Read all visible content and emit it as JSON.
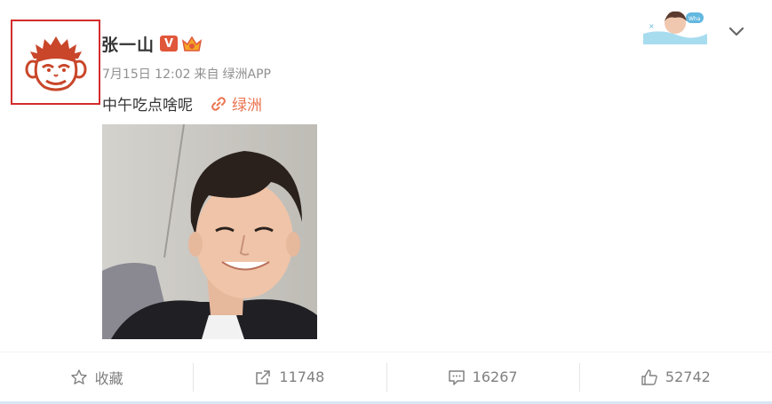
{
  "author": {
    "name": "张一山",
    "verified_badge": "V"
  },
  "post": {
    "date": "7月15日 12:02",
    "source_prefix": "来自",
    "source_app": "绿洲APP",
    "text": "中午吃点啥呢",
    "link_label": "绿洲"
  },
  "actions": {
    "favorite_label": "收藏",
    "repost_count": "11748",
    "comment_count": "16267",
    "like_count": "52742"
  },
  "icons": {
    "avatar": "monkey-face-avatar",
    "verified": "verified-v-badge",
    "member": "member-crown-badge",
    "link": "link-icon",
    "chevron": "chevron-down-icon",
    "favorite": "star-icon",
    "repost": "share-arrow-icon",
    "comment": "comment-bubble-icon",
    "like": "thumbs-up-icon"
  },
  "colors": {
    "highlight_border": "#d42c2c",
    "link": "#eb7350",
    "verified_badge": "#e0573a",
    "meta_text": "#909090"
  }
}
